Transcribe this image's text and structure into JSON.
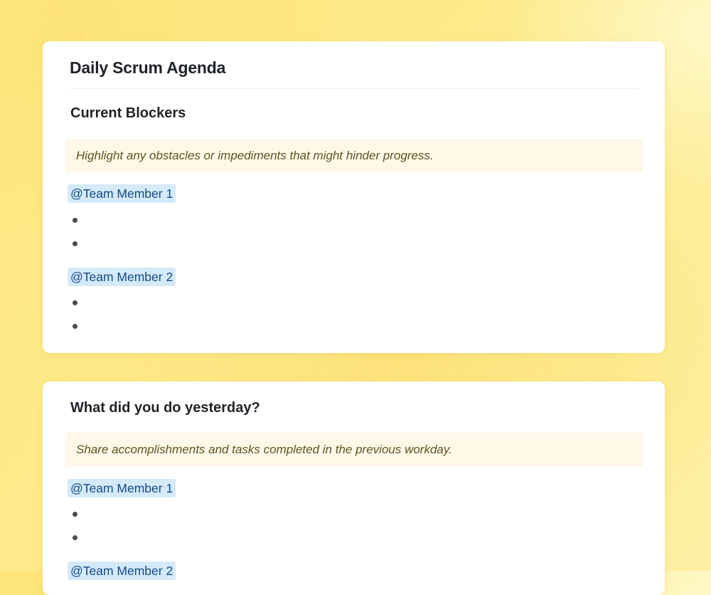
{
  "document": {
    "title": "Daily Scrum Agenda"
  },
  "sections": [
    {
      "heading": "Current Blockers",
      "callout": "Highlight any obstacles or impediments that might hinder progress.",
      "members": [
        {
          "mention": "@Team Member 1",
          "bullets": [
            "",
            ""
          ]
        },
        {
          "mention": "@Team Member 2",
          "bullets": [
            "",
            ""
          ]
        }
      ]
    },
    {
      "heading": "What did you do yesterday?",
      "callout": "Share accomplishments and tasks completed in the previous workday.",
      "members": [
        {
          "mention": "@Team Member 1",
          "bullets": [
            "",
            ""
          ]
        },
        {
          "mention": "@Team Member 2",
          "bullets": []
        }
      ]
    }
  ],
  "colors": {
    "mention_bg": "#d5eaf9",
    "mention_text": "#124a86",
    "callout_bg": "#fff8e8",
    "callout_text": "#5c5320",
    "background_accent": "#fde47a"
  }
}
